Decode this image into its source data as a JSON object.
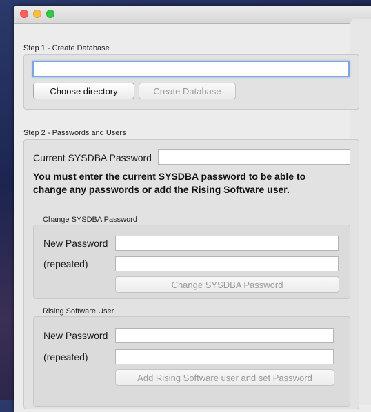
{
  "step1": {
    "title": "Step 1 - Create Database",
    "path_value": "",
    "choose_dir_label": "Choose directory",
    "create_db_label": "Create Database"
  },
  "step2": {
    "title": "Step 2 - Passwords and Users",
    "current_pw_label": "Current SYSDBA Password",
    "warning_line1": "You must enter the current SYSDBA password to be able to",
    "warning_line2": "change any passwords or add the Rising Software user.",
    "change_sysdba": {
      "title": "Change SYSDBA Password",
      "new_pw_label": "New Password",
      "repeated_label": "(repeated)",
      "button_label": "Change SYSDBA Password"
    },
    "rising_user": {
      "title": "Rising Software User",
      "new_pw_label": "New Password",
      "repeated_label": "(repeated)",
      "button_label": "Add Rising Software user and set Password"
    }
  }
}
